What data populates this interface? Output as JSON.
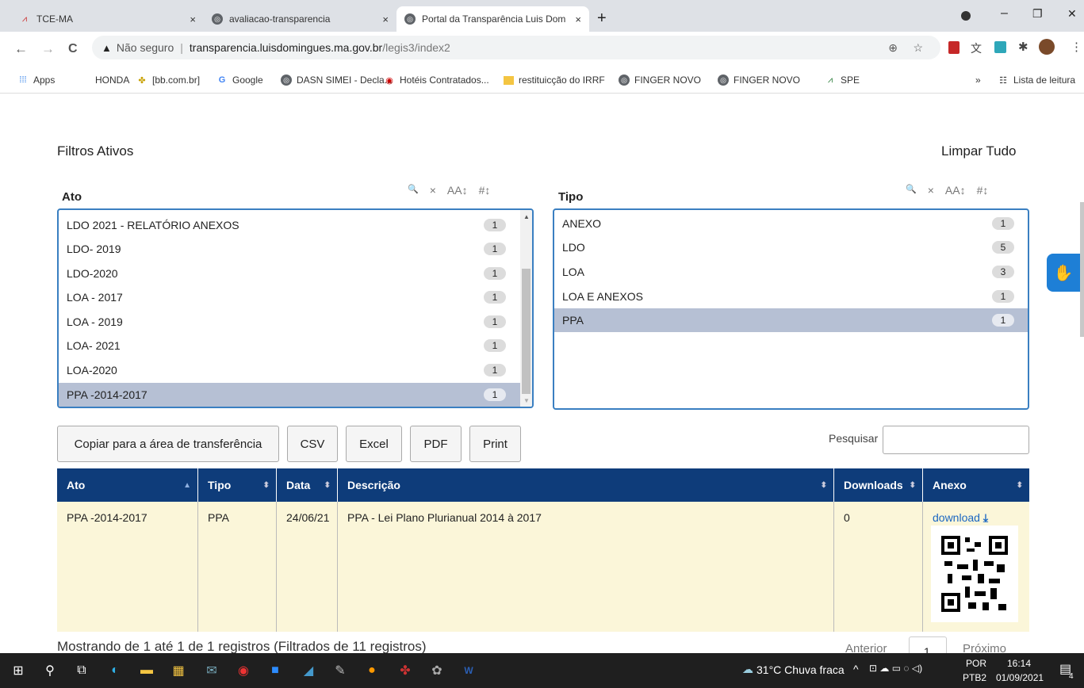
{
  "browser": {
    "tabs": [
      {
        "label": "TCE-MA",
        "close": "×"
      },
      {
        "label": "avaliacao-transparencia",
        "close": "×"
      },
      {
        "label": "Portal da Transparência Luis Dom",
        "close": "×"
      }
    ],
    "new_tab": "+",
    "window_controls": {
      "minimize": "–",
      "restore": "❐",
      "close": "✕"
    },
    "nav": {
      "back": "←",
      "forward": "→",
      "reload": "C"
    },
    "security_label": "Não seguro",
    "url_domain": "transparencia.luisdomingues.ma.gov.br",
    "url_path": "/legis3/index2",
    "bookmarks": [
      "Apps",
      "HONDA",
      "[bb.com.br]",
      "Google",
      "DASN SIMEI - Decla...",
      "Hotéis Contratados...",
      "restituicção do IRRF",
      "FINGER NOVO",
      "FINGER NOVO",
      "SPE"
    ],
    "bookmarks_overflow": "»",
    "reading_list": "Lista de leitura"
  },
  "page": {
    "filters_title": "Filtros Ativos",
    "clear_all": "Limpar Tudo",
    "ato_filter": {
      "title": "Ato",
      "tools": [
        "🔍",
        "×",
        "AA↕",
        "#↕"
      ],
      "items": [
        {
          "label": "LDO 2021 - RELATÓRIO ANEXOS",
          "count": "1"
        },
        {
          "label": "LDO- 2019",
          "count": "1"
        },
        {
          "label": "LDO-2020",
          "count": "1"
        },
        {
          "label": "LOA - 2017",
          "count": "1"
        },
        {
          "label": "LOA - 2019",
          "count": "1"
        },
        {
          "label": "LOA- 2021",
          "count": "1"
        },
        {
          "label": "LOA-2020",
          "count": "1"
        },
        {
          "label": "PPA -2014-2017",
          "count": "1",
          "selected": true
        }
      ]
    },
    "tipo_filter": {
      "title": "Tipo",
      "tools": [
        "🔍",
        "×",
        "AA↕",
        "#↕"
      ],
      "items": [
        {
          "label": "ANEXO",
          "count": "1"
        },
        {
          "label": "LDO",
          "count": "5"
        },
        {
          "label": "LOA",
          "count": "3"
        },
        {
          "label": "LOA E ANEXOS",
          "count": "1"
        },
        {
          "label": "PPA",
          "count": "1",
          "selected": true
        }
      ]
    },
    "buttons": {
      "copy": "Copiar para a área de transferência",
      "csv": "CSV",
      "excel": "Excel",
      "pdf": "PDF",
      "print": "Print"
    },
    "search_label": "Pesquisar",
    "search_value": "",
    "table": {
      "headers": [
        "Ato",
        "Tipo",
        "Data",
        "Descrição",
        "Downloads",
        "Anexo"
      ],
      "rows": [
        {
          "ato": "PPA -2014-2017",
          "tipo": "PPA",
          "data": "24/06/21",
          "descricao": "PPA - Lei Plano Plurianual 2014 à 2017",
          "downloads": "0",
          "anexo": "download"
        }
      ]
    },
    "footer_info": "Mostrando de 1 até 1 de 1 registros (Filtrados de 11 registros)",
    "pagination": {
      "prev": "Anterior",
      "page": "1",
      "next": "Próximo"
    }
  },
  "taskbar": {
    "weather": "31°C Chuva fraca",
    "lang_top": "POR",
    "lang_bottom": "PTB2",
    "time": "16:14",
    "date": "01/09/2021",
    "notifications": "4"
  },
  "colors": {
    "table_header": "#0e3c7a",
    "filter_border": "#3a7fc1",
    "selected_row": "#b6c0d4",
    "row_bg": "#fbf6d9",
    "link": "#1a66c2"
  }
}
